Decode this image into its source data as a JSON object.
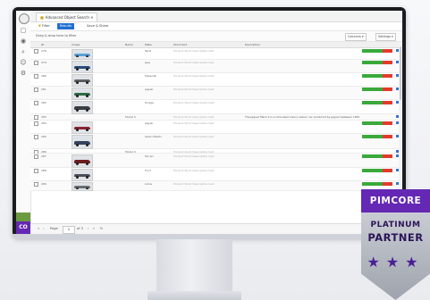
{
  "window": {
    "tab_title": "Advanced Object Search",
    "toolbar": {
      "filter_label": "Filter",
      "results_label": "Results",
      "save_label": "Save & Share"
    },
    "subbar": {
      "info": "Drag & drop here to filter",
      "select_left": "Columns",
      "select_right": "Settings"
    }
  },
  "grid": {
    "columns": [
      "",
      "ID",
      "Image",
      "Name",
      "Make",
      "Short text",
      "Description",
      "",
      ""
    ],
    "rows": [
      {
        "id": "278",
        "img": true,
        "name": "",
        "make": "Tesla",
        "short": "Product Short Description text",
        "desc": "",
        "color": "#5aa0d8",
        "h": 12
      },
      {
        "id": "279",
        "img": true,
        "name": "",
        "make": "Jeep",
        "short": "Product Short Description text",
        "desc": "",
        "color": "#2a4a7a",
        "h": 14
      },
      {
        "id": "280",
        "img": true,
        "name": "",
        "make": "Maserati",
        "short": "Product Short Description text",
        "desc": "",
        "color": "#5c5e61",
        "h": 14
      },
      {
        "id": "281",
        "img": true,
        "name": "",
        "make": "Jaguar",
        "short": "Product Short Description text",
        "desc": "",
        "color": "#2f6b46",
        "h": 14
      },
      {
        "id": "282",
        "img": true,
        "name": "",
        "make": "Dodge",
        "short": "Product Short Description text",
        "desc": "",
        "color": "#3a3d42",
        "h": 15
      },
      {
        "id": "283",
        "img": false,
        "name": "Model S",
        "make": "",
        "short": "Product Short Description text",
        "desc": "The Jaguar Mark 2 is a mid-sized luxury saloon car produced by Jaguar between 1959 and 1967",
        "color": "",
        "h": 6
      },
      {
        "id": "284",
        "img": true,
        "name": "",
        "make": "Jaguar",
        "short": "Product Short Description text",
        "desc": "",
        "color": "#8a2630",
        "h": 14
      },
      {
        "id": "285",
        "img": true,
        "name": "",
        "make": "Aston Martin",
        "short": "Product Short Description text",
        "desc": "",
        "color": "#33435e",
        "h": 16
      },
      {
        "id": "286",
        "img": false,
        "name": "Model X",
        "make": "",
        "short": "Product Short Description text",
        "desc": "",
        "color": "",
        "h": 4
      },
      {
        "id": "287",
        "img": true,
        "name": "",
        "make": "Ferrari",
        "short": "Product Short Description text",
        "desc": "",
        "color": "#6b1d1d",
        "h": 15
      },
      {
        "id": "288",
        "img": true,
        "name": "",
        "make": "Ford",
        "short": "Product Short Description text",
        "desc": "",
        "color": "#4b4f57",
        "h": 14
      },
      {
        "id": "289",
        "img": true,
        "name": "",
        "make": "Lotus",
        "short": "Product Short Description text",
        "desc": "",
        "color": "#6a6d73",
        "h": 10
      }
    ]
  },
  "pager": {
    "page_label": "Page",
    "page_value": "1",
    "of_label": "of 3"
  },
  "rail": {
    "logo": "CO"
  },
  "badge": {
    "brand": "PIMCORE",
    "line1": "PLATINUM",
    "line2": "PARTNER",
    "stars": "★★★"
  }
}
